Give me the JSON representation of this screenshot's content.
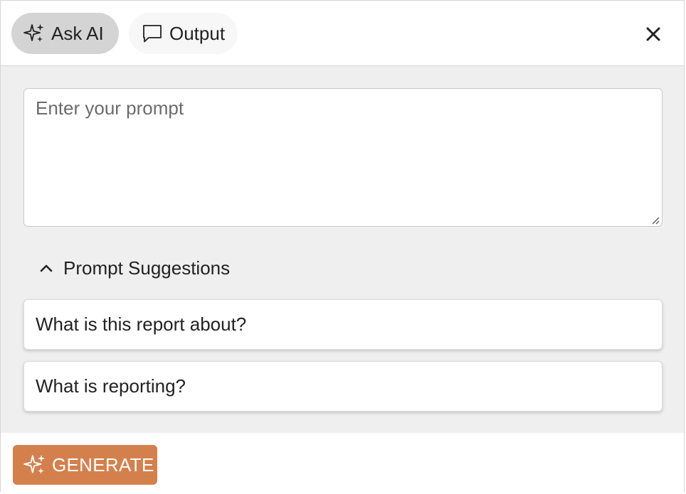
{
  "tabs": {
    "ask_ai": {
      "label": "Ask AI",
      "icon": "sparkles-icon",
      "active": true
    },
    "output": {
      "label": "Output",
      "icon": "chat-bubble-icon",
      "active": false
    }
  },
  "header": {
    "close_icon": "close-icon"
  },
  "prompt": {
    "placeholder": "Enter your prompt",
    "value": ""
  },
  "suggestions": {
    "toggle_label": "Prompt Suggestions",
    "expanded": true,
    "toggle_icon": "chevron-up-icon",
    "items": [
      {
        "label": "What is this report about?"
      },
      {
        "label": "What is reporting?"
      }
    ]
  },
  "footer": {
    "generate_label": "GENERATE",
    "generate_icon": "sparkles-icon"
  },
  "colors": {
    "accent": "#d4804d",
    "active_tab": "#d4d4d4",
    "body_bg": "#efefef"
  }
}
